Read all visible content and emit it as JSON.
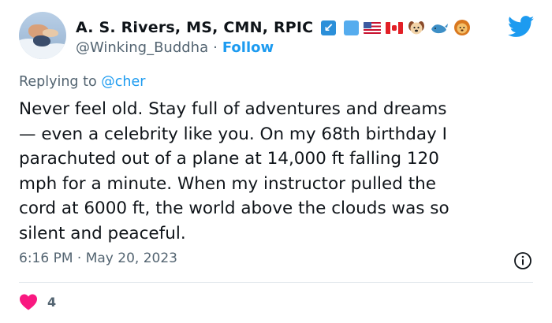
{
  "author": {
    "display_name": "A. S. Rivers, MS, CMN, RPIC",
    "handle": "@Winking_Buddha",
    "separator": "·",
    "follow_label": "Follow",
    "name_emojis": [
      "arrow-box-icon",
      "blue-square-icon",
      "us-flag-icon",
      "canada-flag-icon",
      "dog-face-icon",
      "whale-icon",
      "lion-face-icon"
    ]
  },
  "reply": {
    "prefix": "Replying to",
    "mention": "@cher"
  },
  "tweet": {
    "text": "Never feel old. Stay full of adventures and dreams\n— even a celebrity like you.  On my 68th birthday I\nparachuted out of a plane at 14,000 ft falling 120\nmph for a minute. When my instructor pulled the\ncord at 6000 ft, the world above the clouds was so\nsilent and peaceful.",
    "timestamp": "6:16 PM · May 20, 2023"
  },
  "engagement": {
    "likes": "4"
  },
  "colors": {
    "accent": "#1d9bf0",
    "secondary_text": "#536471",
    "heart": "#f91880",
    "text": "#0f1419"
  },
  "icons": {
    "brand": "twitter-bird-icon",
    "info": "info-icon",
    "like": "heart-icon"
  }
}
